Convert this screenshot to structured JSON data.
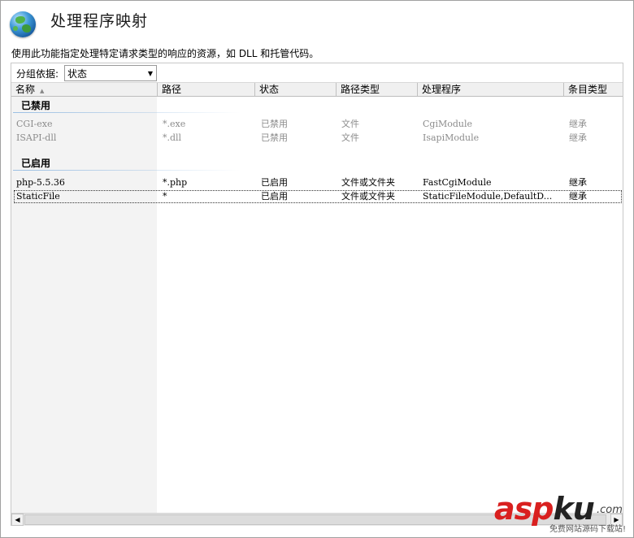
{
  "page": {
    "title": "处理程序映射",
    "description": "使用此功能指定处理特定请求类型的响应的资源，如 DLL 和托管代码。"
  },
  "groupby": {
    "label": "分组依据:",
    "selected": "状态"
  },
  "columns": [
    "名称",
    "路径",
    "状态",
    "路径类型",
    "处理程序",
    "条目类型"
  ],
  "groups": [
    {
      "title": "已禁用",
      "rows": [
        [
          "CGI-exe",
          "*.exe",
          "已禁用",
          "文件",
          "CgiModule",
          "继承"
        ],
        [
          "ISAPI-dll",
          "*.dll",
          "已禁用",
          "文件",
          "IsapiModule",
          "继承"
        ]
      ]
    },
    {
      "title": "已启用",
      "rows": [
        [
          "php-5.5.36",
          "*.php",
          "已启用",
          "文件或文件夹",
          "FastCgiModule",
          "继承"
        ],
        [
          "StaticFile",
          "*",
          "已启用",
          "文件或文件夹",
          "StaticFileModule,DefaultD...",
          "继承"
        ]
      ]
    }
  ],
  "watermark": {
    "brand_red": "asp",
    "brand_dark": "ku",
    "suffix": ".com",
    "tagline": "免费网站源码下载站!"
  },
  "colors": {
    "brand_red": "#d9201f",
    "disabled_text": "#8c8c8c",
    "group_line": "#9bbfe3"
  }
}
